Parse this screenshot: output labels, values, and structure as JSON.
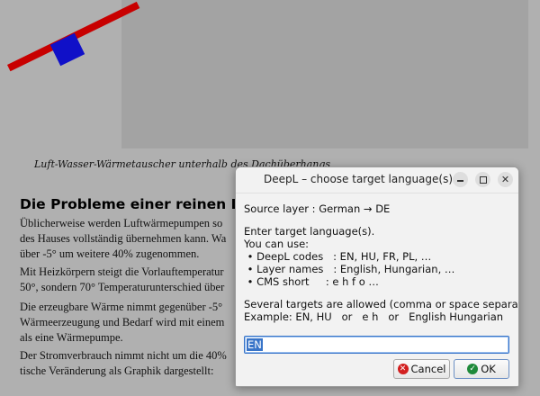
{
  "document": {
    "caption": "Luft-Wasser-Wärmetauscher unterhalb des Dachüberhangs",
    "heading": "Die Probleme einer reinen Luftwär",
    "paragraphs": [
      [
        "Üblicherweise werden Luftwärmepumpen so",
        "des Hauses vollständig übernehmen kann. Wa",
        "über -5° um weitere 40% zugenommen."
      ],
      [
        "Mit Heizkörpern steigt die Vorlauftemperatur",
        "50°, sondern 70° Temperaturunterschied über"
      ],
      [
        "Die erzeugbare Wärme nimmt gegenüber -5°",
        "Wärmeerzeugung und Bedarf wird mit einem",
        "als eine Wärmepumpe."
      ],
      [
        "Der Stromverbrauch nimmt nicht um die 40%",
        "tische Veränderung als Graphik dargestellt:"
      ]
    ]
  },
  "dialog": {
    "title": "DeepL – choose target language(s)",
    "source_label": "Source layer : German",
    "source_arrow": "→",
    "source_code": "DE",
    "prompt": "Enter target language(s).",
    "you_can_use": "You can use:",
    "bullets": [
      " • DeepL codes   : EN, HU, FR, PL, …",
      " • Layer names   : English, Hungarian, …",
      " • CMS short     : e h f o …"
    ],
    "note": "Several targets are allowed (comma or space separated).",
    "example": "Example: EN, HU   or   e h   or   English Hungarian",
    "input_value": "EN",
    "cancel_label": "Cancel",
    "ok_label": "OK"
  },
  "colors": {
    "accent": "#3874c8",
    "cancel_icon": "#d21f1f",
    "ok_icon": "#1f8a3a"
  }
}
